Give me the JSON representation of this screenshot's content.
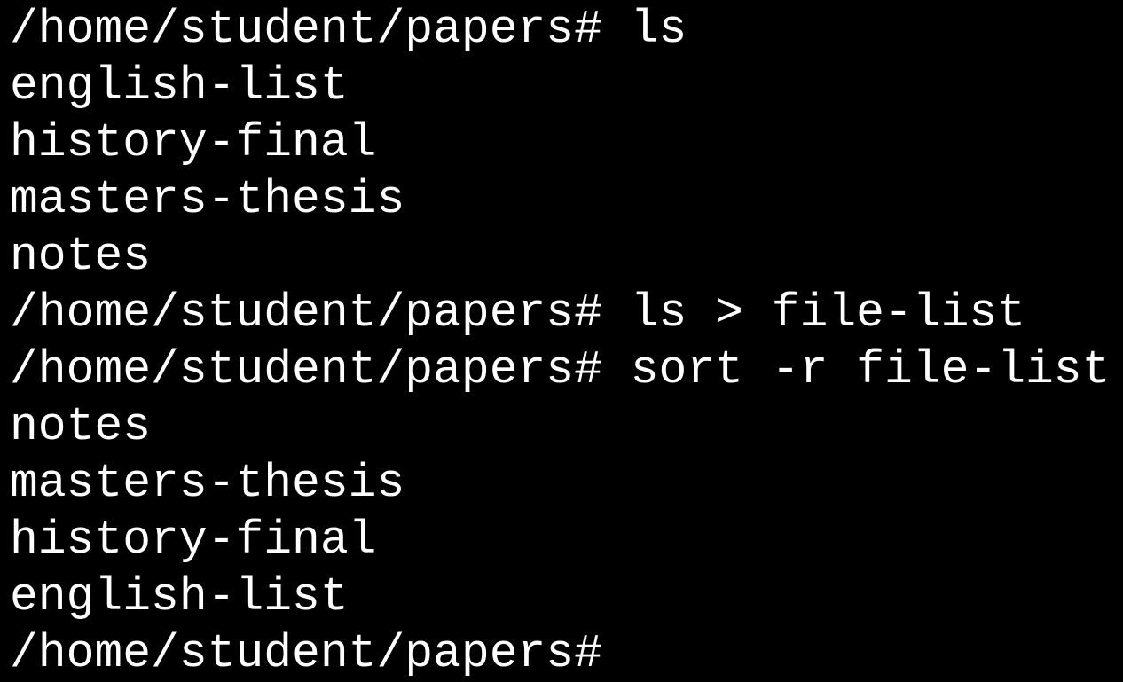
{
  "terminal": {
    "prompt": "/home/student/papers#",
    "lines": [
      {
        "kind": "command",
        "prompt": "/home/student/papers#",
        "command": "ls"
      },
      {
        "kind": "output",
        "text": "english-list"
      },
      {
        "kind": "output",
        "text": "history-final"
      },
      {
        "kind": "output",
        "text": "masters-thesis"
      },
      {
        "kind": "output",
        "text": "notes"
      },
      {
        "kind": "command",
        "prompt": "/home/student/papers#",
        "command": "ls > file-list"
      },
      {
        "kind": "command",
        "prompt": "/home/student/papers#",
        "command": "sort -r file-list"
      },
      {
        "kind": "output",
        "text": "notes"
      },
      {
        "kind": "output",
        "text": "masters-thesis"
      },
      {
        "kind": "output",
        "text": "history-final"
      },
      {
        "kind": "output",
        "text": "english-list"
      },
      {
        "kind": "command",
        "prompt": "/home/student/papers#",
        "command": ""
      }
    ]
  },
  "colors": {
    "background": "#000000",
    "foreground": "#ffffff"
  }
}
